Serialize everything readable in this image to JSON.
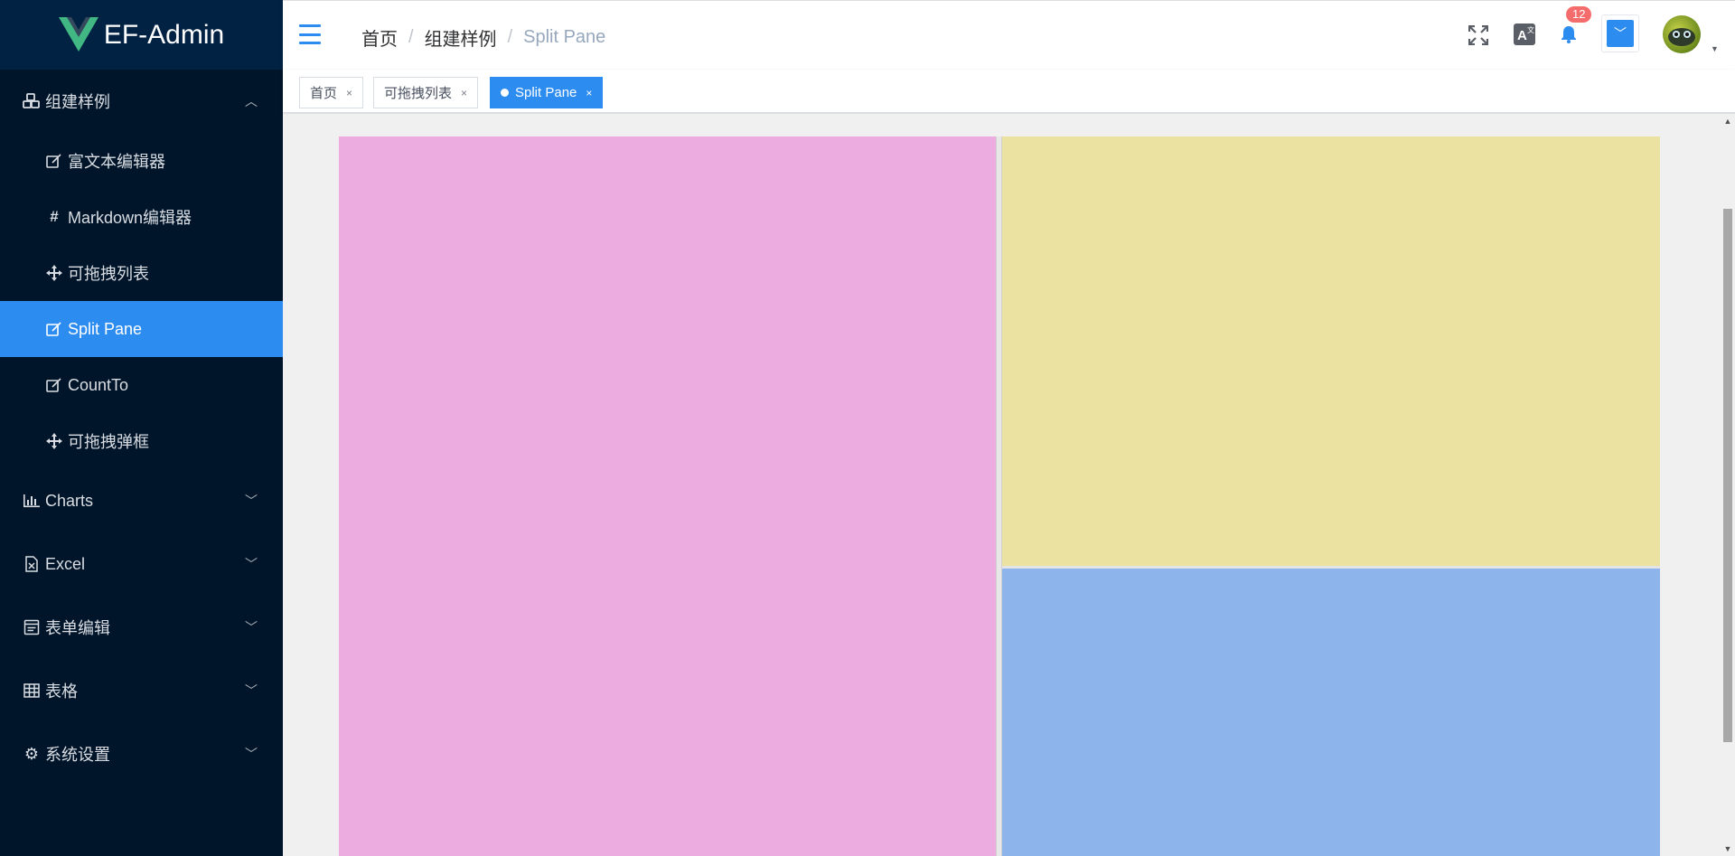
{
  "app": {
    "logo_text": "EF-Admin",
    "brand_color": "#41b883",
    "accent_color": "#2d8cf0"
  },
  "sidebar": {
    "groups": [
      {
        "label": "组建样例",
        "icon": "cubes-icon",
        "expanded": true,
        "items": [
          {
            "label": "富文本编辑器",
            "icon": "edit-icon"
          },
          {
            "label": "Markdown编辑器",
            "icon": "hashtag-icon"
          },
          {
            "label": "可拖拽列表",
            "icon": "move-icon"
          },
          {
            "label": "Split Pane",
            "icon": "edit-icon",
            "active": true
          },
          {
            "label": "CountTo",
            "icon": "edit-icon"
          },
          {
            "label": "可拖拽弹框",
            "icon": "move-icon"
          }
        ]
      },
      {
        "label": "Charts",
        "icon": "bar-chart-icon",
        "expanded": false
      },
      {
        "label": "Excel",
        "icon": "excel-file-icon",
        "expanded": false
      },
      {
        "label": "表单编辑",
        "icon": "form-icon",
        "expanded": false
      },
      {
        "label": "表格",
        "icon": "table-icon",
        "expanded": false
      },
      {
        "label": "系统设置",
        "icon": "gear-icon",
        "expanded": false
      }
    ]
  },
  "header": {
    "breadcrumb": [
      "首页",
      "组建样例",
      "Split Pane"
    ],
    "notification_count": "12"
  },
  "tags": [
    {
      "label": "首页",
      "close": "×"
    },
    {
      "label": "可拖拽列表",
      "close": "×"
    },
    {
      "label": "Split Pane",
      "close": "×",
      "active": true
    }
  ],
  "split_pane": {
    "left_color": "#ecacdf",
    "top_right_color": "#ebe2a2",
    "bottom_right_color": "#8db4eb"
  }
}
